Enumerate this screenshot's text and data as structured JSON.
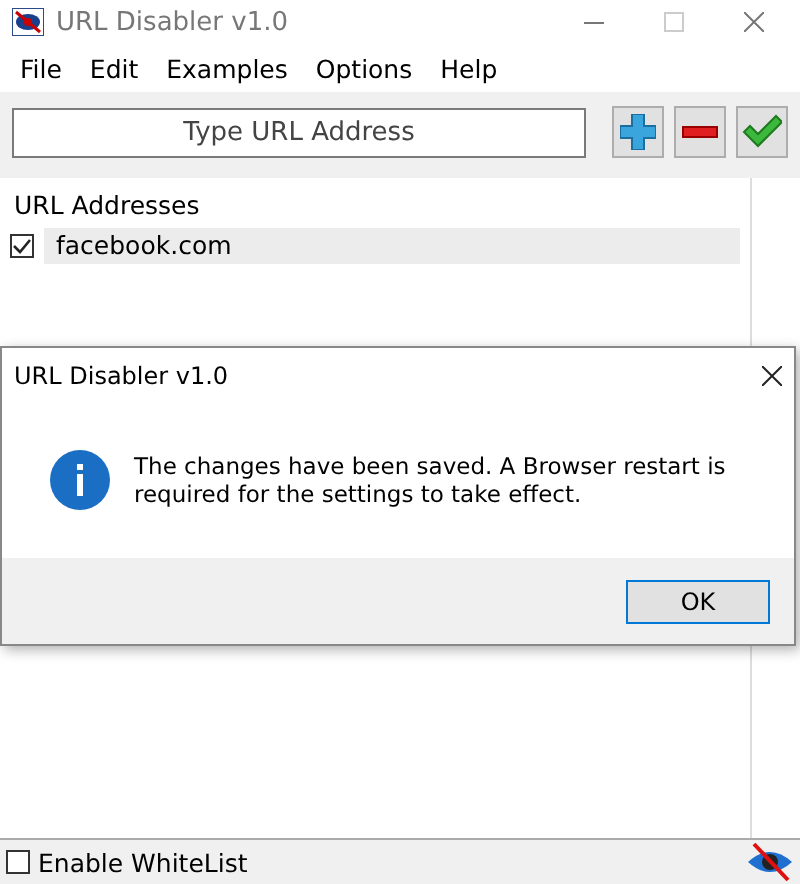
{
  "window": {
    "title": "URL Disabler v1.0"
  },
  "menu": [
    "File",
    "Edit",
    "Examples",
    "Options",
    "Help"
  ],
  "url_field": {
    "placeholder": "Type URL Address"
  },
  "list": {
    "heading": "URL Addresses",
    "items": [
      {
        "label": "facebook.com",
        "checked": true,
        "selected": true
      }
    ]
  },
  "whitelist": {
    "label": "Enable WhiteList",
    "checked": false
  },
  "dialog": {
    "title": "URL Disabler v1.0",
    "message": "The changes have been saved. A Browser restart is required for the settings to take effect.",
    "button": "OK"
  }
}
